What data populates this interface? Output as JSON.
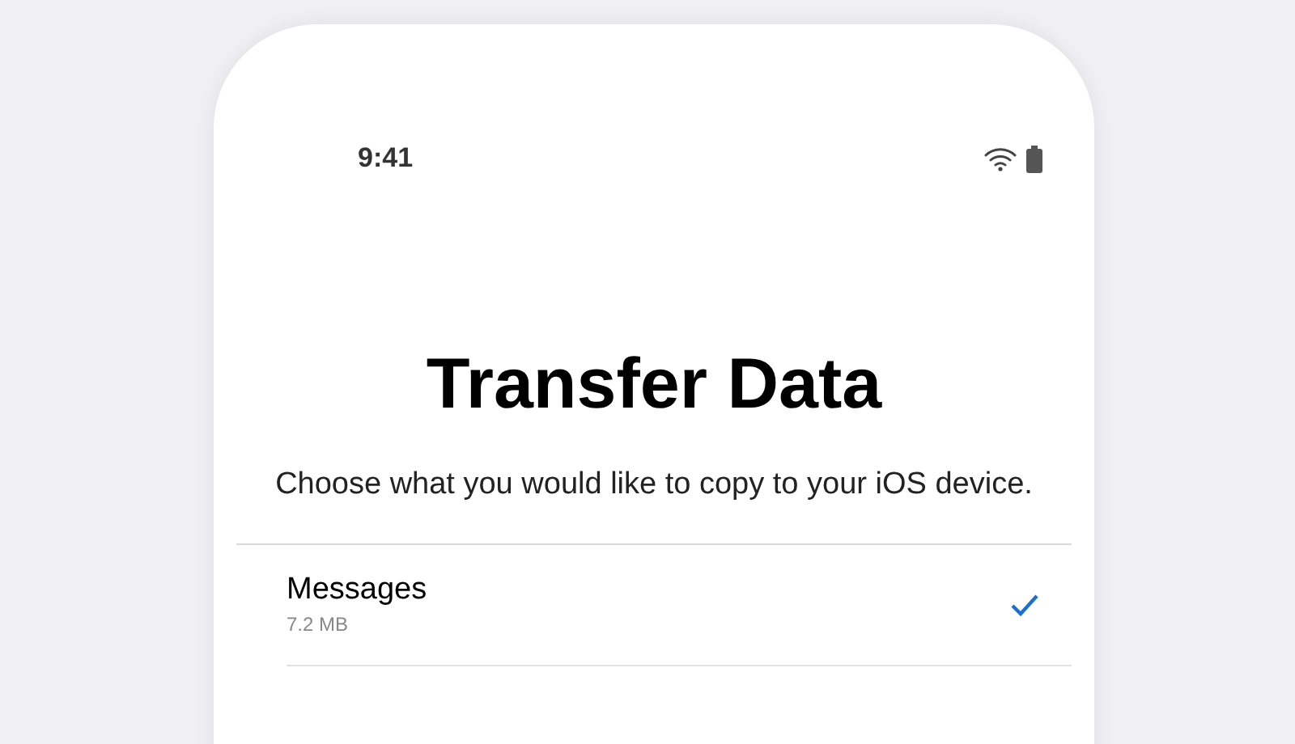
{
  "status_bar": {
    "time": "9:41"
  },
  "title": "Transfer Data",
  "subtitle": "Choose what you would like to copy to your iOS device.",
  "items": [
    {
      "label": "Messages",
      "size": "7.2 MB",
      "selected": true
    }
  ]
}
